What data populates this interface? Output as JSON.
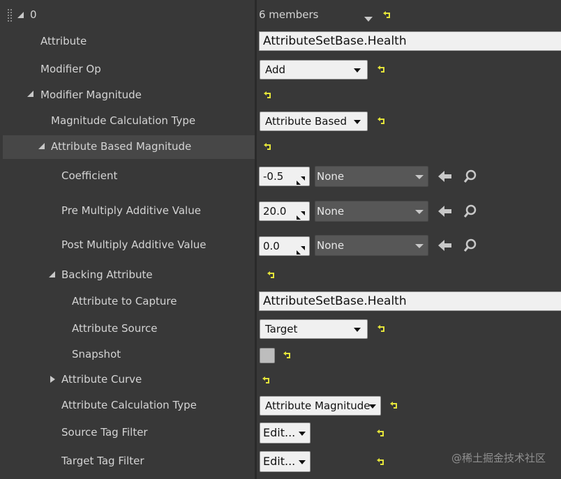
{
  "header": {
    "index": "0",
    "members": "6 members"
  },
  "rows": {
    "attribute": {
      "label": "Attribute",
      "value": "AttributeSetBase.Health"
    },
    "modifier_op": {
      "label": "Modifier Op",
      "value": "Add"
    },
    "modifier_magnitude": {
      "label": "Modifier Magnitude"
    },
    "magnitude_calc_type": {
      "label": "Magnitude Calculation Type",
      "value": "Attribute Based"
    },
    "attribute_based_magnitude": {
      "label": "Attribute Based Magnitude"
    },
    "coefficient": {
      "label": "Coefficient",
      "value": "-0.5",
      "curve": "None"
    },
    "pre_multiply": {
      "label": "Pre Multiply Additive Value",
      "value": "20.0",
      "curve": "None"
    },
    "post_multiply": {
      "label": "Post Multiply Additive Value",
      "value": "0.0",
      "curve": "None"
    },
    "backing_attribute": {
      "label": "Backing Attribute"
    },
    "attribute_to_capture": {
      "label": "Attribute to Capture",
      "value": "AttributeSetBase.Health"
    },
    "attribute_source": {
      "label": "Attribute Source",
      "value": "Target"
    },
    "snapshot": {
      "label": "Snapshot",
      "checked": false
    },
    "attribute_curve": {
      "label": "Attribute Curve"
    },
    "attribute_calc_type": {
      "label": "Attribute Calculation Type",
      "value": "Attribute Magnitude"
    },
    "source_tag_filter": {
      "label": "Source Tag Filter",
      "value": "Edit..."
    },
    "target_tag_filter": {
      "label": "Target Tag Filter",
      "value": "Edit..."
    }
  },
  "icons": {
    "reset": "reset-to-default-icon",
    "use_selected": "use-selected-asset-arrow-icon",
    "browse": "browse-magnifier-icon",
    "spin": "numeric-spin-drag-icon"
  },
  "colors": {
    "reset_yellow": "#e4e43a",
    "panel_bg": "#383838",
    "highlight_row": "#474747"
  },
  "watermark": "@稀土掘金技术社区"
}
